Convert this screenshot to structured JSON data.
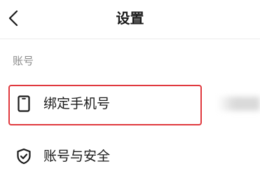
{
  "header": {
    "title": "设置",
    "back_icon": "chevron-left-icon"
  },
  "sections": [
    {
      "title": "账号",
      "items": [
        {
          "label": "绑定手机号",
          "icon": "phone-icon",
          "highlighted": true,
          "highlight_color": "#e0393e"
        },
        {
          "label": "账号与安全",
          "icon": "shield-check-icon"
        }
      ]
    }
  ]
}
